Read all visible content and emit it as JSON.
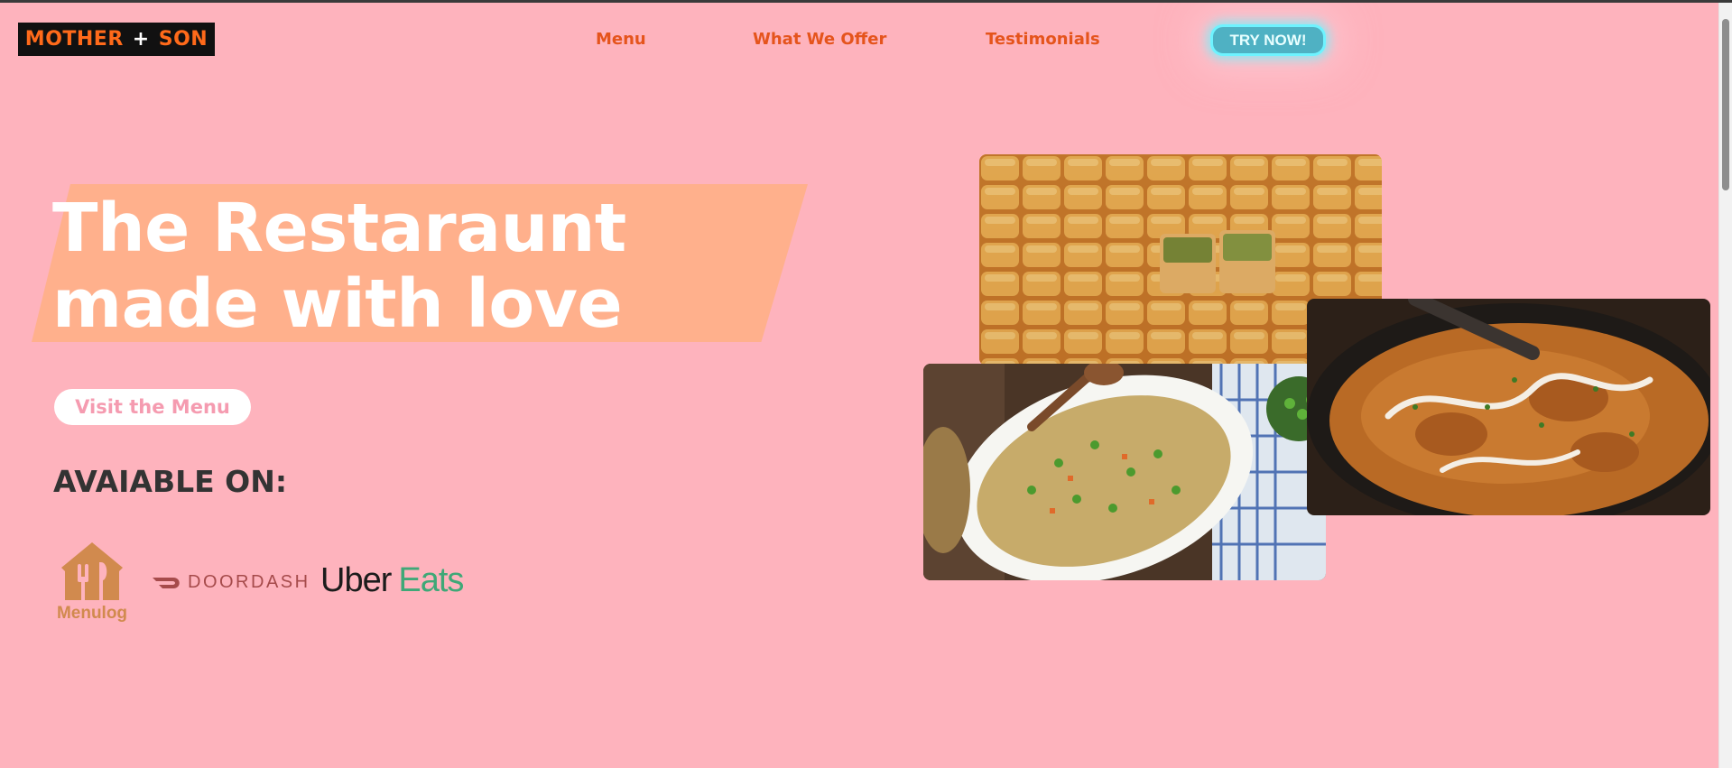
{
  "nav": {
    "logo_left": "MOTHER",
    "logo_plus": "+",
    "logo_right": "SON",
    "links": [
      {
        "label": "Menu"
      },
      {
        "label": "What We Offer"
      },
      {
        "label": "Testimonials"
      }
    ],
    "cta_label": "TRY NOW!"
  },
  "hero": {
    "title_line1": "The Restaraunt",
    "title_line2": "made with love",
    "cta_label": "Visit the Menu",
    "available_heading": "AVAIABLE ON:"
  },
  "partners": {
    "menulog": "Menulog",
    "doordash": "DOORDASH",
    "uber": "Uber",
    "eats": "Eats"
  },
  "photos": [
    {
      "icon": "baklava-photo"
    },
    {
      "icon": "butter-chicken-photo"
    },
    {
      "icon": "fried-rice-photo"
    }
  ],
  "colors": {
    "background": "#feb3bd",
    "accent_orange": "#e5541c",
    "stripe": "#ffb08c",
    "cta_cyan": "#6ef3ff",
    "uber_eats_green": "#3fa877"
  }
}
